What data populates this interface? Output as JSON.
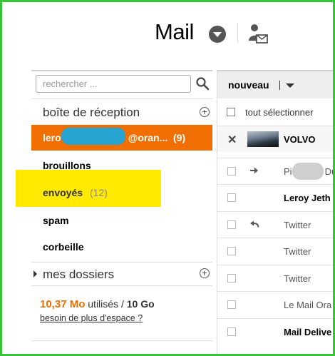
{
  "header": {
    "title": "Mail",
    "icons": {
      "menu": "chevron-down-circle-icon",
      "account": "user-mail-icon"
    }
  },
  "sidebar": {
    "search": {
      "placeholder": "rechercher ...",
      "value": ""
    },
    "inbox_label": "boîte de réception",
    "account": {
      "address_start": "lero",
      "address_end": "@oran...",
      "unread_count": "(9)"
    },
    "folders": {
      "drafts": "brouillons",
      "sent": "envoyés",
      "sent_count": "(12)",
      "spam": "spam",
      "trash": "corbeille"
    },
    "my_folders_label": "mes dossiers",
    "storage": {
      "used_value": "10,37 Mo",
      "used_label": "utilisés /",
      "total": "10 Go",
      "more_space_link": "besoin de plus d'espace ?"
    }
  },
  "toolbar": {
    "new_label": "nouveau"
  },
  "message_list": {
    "select_all_label": "tout sélectionner",
    "rows": [
      {
        "sender": "VOLVO"
      },
      {
        "sender_start": "Pi",
        "sender_end": "Du"
      },
      {
        "sender": "Leroy Jeth"
      },
      {
        "sender": "Twitter"
      },
      {
        "sender": "Twitter"
      },
      {
        "sender": "Twitter"
      },
      {
        "sender": "Le Mail Ora"
      },
      {
        "sender": "Mail Delive"
      }
    ]
  },
  "colors": {
    "accent_orange": "#f16e00",
    "highlight_yellow": "#ffea00",
    "redaction_blue": "#27a4cf",
    "frame_green": "#35c435"
  }
}
